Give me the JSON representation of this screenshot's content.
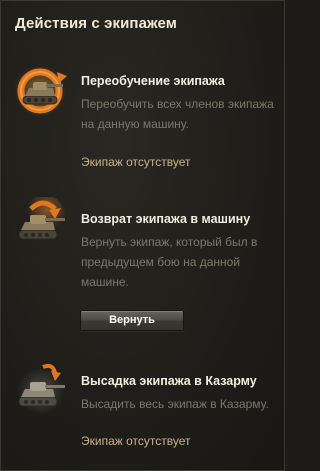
{
  "panel": {
    "title": "Действия с экипажем"
  },
  "actions": [
    {
      "icon": "tank-retrain-icon",
      "title": "Переобучение экипажа",
      "description": "Переобучить всех членов экипажа на данную машину.",
      "status": "Экипаж отсутствует"
    },
    {
      "icon": "tank-return-crew-icon",
      "title": "Возврат экипажа в машину",
      "description": "Вернуть экипаж, который был в предыдущем бою на данной машине.",
      "button_label": "Вернуть"
    },
    {
      "icon": "tank-barracks-icon",
      "title": "Высадка экипажа в Казарму",
      "description": "Высадить весь экипаж в Казарму.",
      "status": "Экипаж отсутствует"
    }
  ],
  "colors": {
    "accent_orange": "#e0781e",
    "heading": "#f2eddd",
    "status": "#c9b48a",
    "description": "#7c786d"
  }
}
